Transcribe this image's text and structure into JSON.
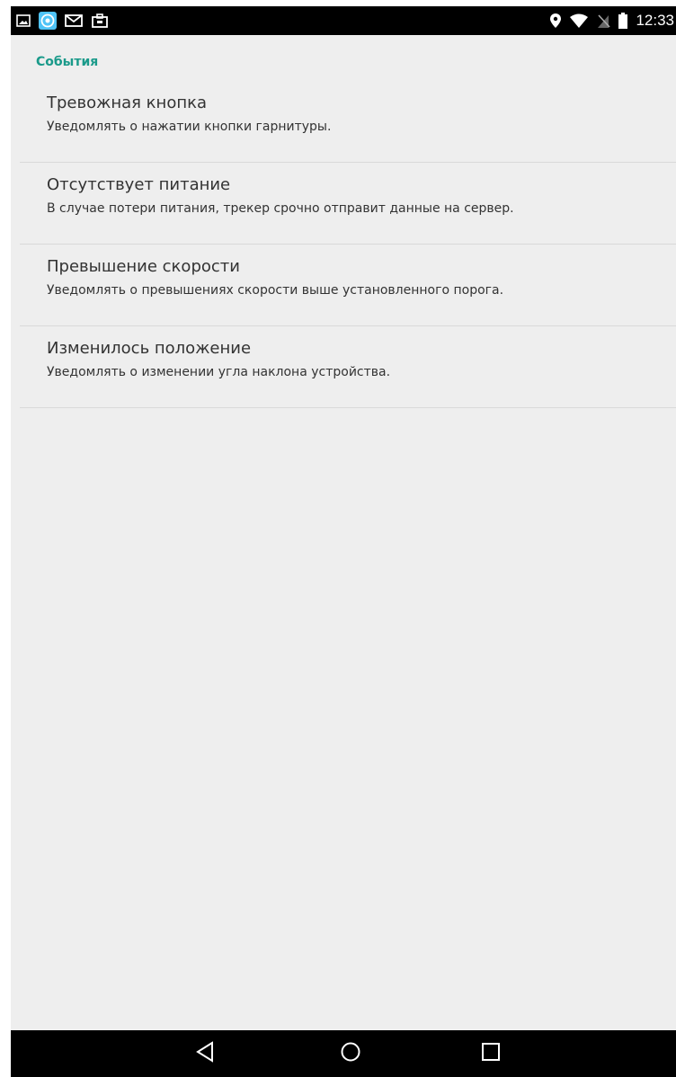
{
  "status_bar": {
    "left_icons": [
      "image-icon",
      "app-location-icon",
      "mail-icon",
      "briefcase-icon"
    ],
    "right_icons": [
      "location-pin-icon",
      "wifi-icon",
      "no-sim-icon",
      "battery-icon"
    ],
    "time": "12:33",
    "accent_app_color": "#4fc3f7"
  },
  "category": {
    "title": "События",
    "color": "#1a9a8a"
  },
  "items": [
    {
      "title": "Тревожная кнопка",
      "summary": "Уведомлять о нажатии кнопки гарнитуры."
    },
    {
      "title": "Отсутствует питание",
      "summary": "В случае потери питания, трекер срочно отправит данные на сервер."
    },
    {
      "title": "Превышение скорости",
      "summary": "Уведомлять о превышениях скорости выше установленного порога."
    },
    {
      "title": "Изменилось положение",
      "summary": "Уведомлять о изменении угла наклона устройства."
    }
  ],
  "nav_bar": {
    "buttons": [
      "back-icon",
      "home-icon",
      "recents-icon"
    ]
  }
}
